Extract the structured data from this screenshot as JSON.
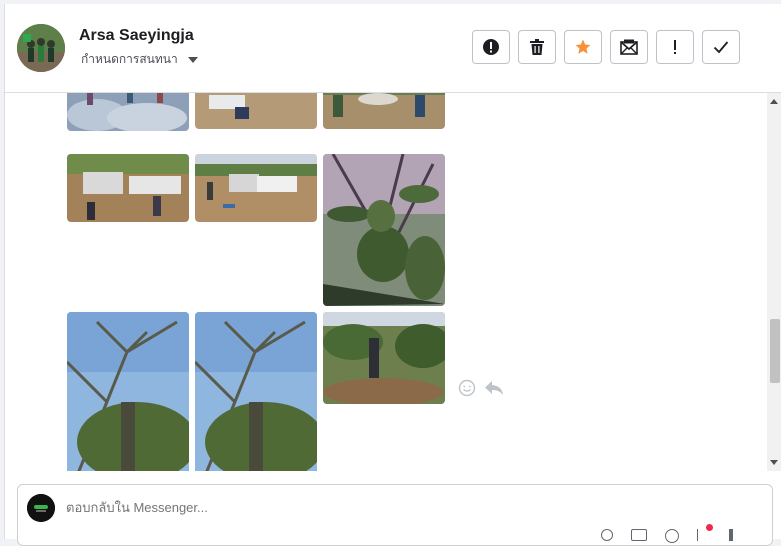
{
  "header": {
    "name": "Arsa Saeyingja",
    "subtitle": "กำหนดการสนทนา"
  },
  "actions": [
    {
      "icon": "exclamation-circle-icon"
    },
    {
      "icon": "trash-icon"
    },
    {
      "icon": "star-icon",
      "color": "#f7923a"
    },
    {
      "icon": "mail-envelope-icon"
    },
    {
      "icon": "exclamation-icon"
    },
    {
      "icon": "checkmark-icon"
    }
  ],
  "composer": {
    "placeholder": "ตอบกลับใน Messenger..."
  }
}
